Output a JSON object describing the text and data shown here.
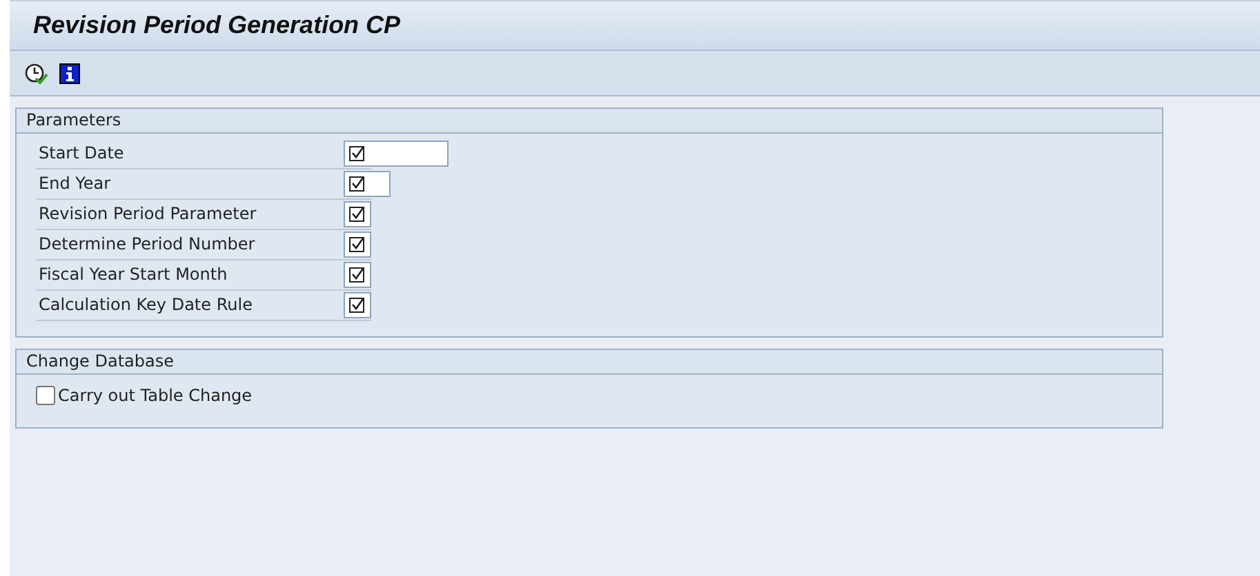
{
  "window": {
    "title": "Revision Period Generation CP"
  },
  "toolbar": [
    {
      "kind": "execute"
    },
    {
      "kind": "info"
    }
  ],
  "parameters": {
    "title": "Parameters",
    "fields": [
      {
        "label": "Start Date",
        "kind": "date",
        "required": true
      },
      {
        "label": "End Year",
        "kind": "year",
        "required": true
      },
      {
        "label": "Revision Period Parameter",
        "kind": "short",
        "required": true
      },
      {
        "label": "Determine Period Number",
        "kind": "short",
        "required": true
      },
      {
        "label": "Fiscal Year Start Month",
        "kind": "short",
        "required": true
      },
      {
        "label": "Calculation Key Date Rule",
        "kind": "short",
        "required": true
      }
    ]
  },
  "change_database": {
    "title": "Change Database",
    "options": [
      {
        "label": "Carry out Table Change",
        "checked": false
      }
    ]
  }
}
